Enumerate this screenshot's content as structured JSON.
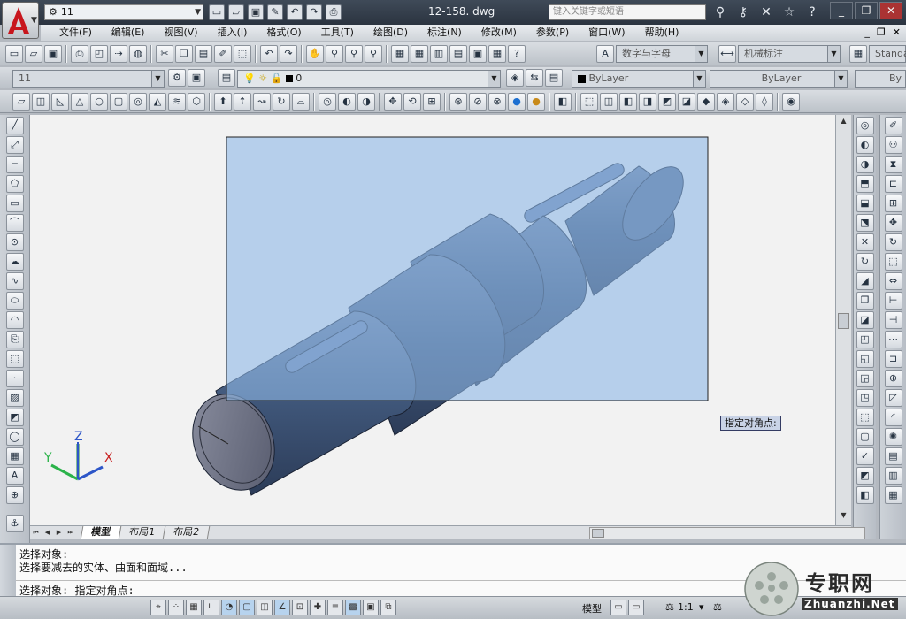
{
  "titlebar": {
    "workspace": "11",
    "title": "12-158. dwg",
    "search_placeholder": "键入关键字或短语"
  },
  "menus": [
    "文件(F)",
    "编辑(E)",
    "视图(V)",
    "插入(I)",
    "格式(O)",
    "工具(T)",
    "绘图(D)",
    "标注(N)",
    "修改(M)",
    "参数(P)",
    "窗口(W)",
    "帮助(H)"
  ],
  "toolbar1": {
    "text_style": "数字与字母",
    "dim_style": "机械标注",
    "table_style": "Standa"
  },
  "toolbar2": {
    "workspace": "11",
    "layer": "0",
    "color": "ByLayer",
    "linetype": "ByLayer",
    "lineweight": "By"
  },
  "canvas": {
    "tooltip": "指定对角点:",
    "ucs": {
      "x": "X",
      "y": "Y",
      "z": "Z"
    }
  },
  "layout_tabs": [
    "模型",
    "布局1",
    "布局2"
  ],
  "command": {
    "line1": "选择对象:",
    "line2": "选择要减去的实体、曲面和面域...",
    "prompt": "选择对象: 指定对角点:"
  },
  "status": {
    "model": "模型",
    "scale": "1:1"
  },
  "watermark": {
    "zh": "专职网",
    "en": "Zhuanzhi.Net"
  },
  "colors": {
    "selection_fill": "#a9c9ea",
    "shaft": "#4b6488",
    "titlebar": "#2f3946"
  }
}
